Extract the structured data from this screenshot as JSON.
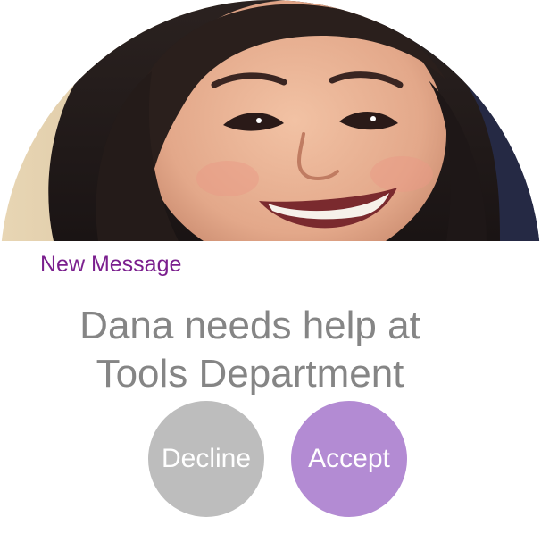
{
  "notification": {
    "header": "New Message",
    "message_line1": "Dana needs help at",
    "message_line2": "Tools Department"
  },
  "actions": {
    "decline_label": "Decline",
    "accept_label": "Accept"
  },
  "avatar": {
    "icon": "person-photo",
    "accent_color": "#7b1f8e"
  },
  "colors": {
    "header": "#7b1f8e",
    "message_text": "#858585",
    "decline_bg": "#bdbdbd",
    "accept_bg": "#b38bd3"
  }
}
